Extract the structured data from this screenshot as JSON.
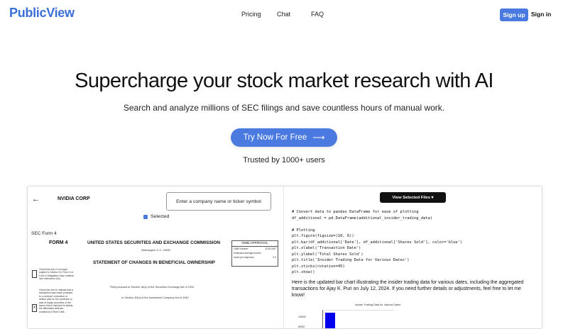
{
  "brand": {
    "name": "PublicView",
    "color": "#3b6fd8"
  },
  "nav": {
    "links": [
      "Pricing",
      "Chat",
      "FAQ"
    ],
    "signup": "Sign up",
    "signin": "Sign in"
  },
  "hero": {
    "title": "Supercharge your stock market research with AI",
    "subtitle": "Search and analyze millions of SEC filings and save countless hours of manual work.",
    "cta": "Try Now For Free",
    "cta_arrow": "⟶",
    "trusted": "Trusted by 1000+ users"
  },
  "app": {
    "back_arrow": "←",
    "company": "NVIDIA CORP",
    "search_placeholder": "Enter a company name or ticker symbol",
    "selected_label": "Selected",
    "doc": {
      "form_line": "SEC Form 4",
      "form4": "FORM 4",
      "commission": "UNITED STATES SECURITIES AND EXCHANGE COMMISSION",
      "city": "Washington, D.C. 20549",
      "statement": "STATEMENT OF CHANGES IN BENEFICIAL OWNERSHIP",
      "filed_1": "Filed pursuant to Section 16(a) of the Securities Exchange Act of 1934",
      "filed_2": "or Section 30(h) of the Investment Company Act of 1940",
      "omb_title": "OMB APPROVAL",
      "omb_number_label": "OMB Number:",
      "omb_number": "3235-0287",
      "omb_burden_label": "Estimated average burden",
      "omb_hours_label": "hours per response:",
      "omb_hours": "0.5",
      "check1": "Check this box if no longer subject to Section 16. Form 4 or Form 5 obligations may continue. See Instruction 1(b).",
      "check2": "Check this box to indicate that a transaction was made pursuant to a contract, instruction or written plan for the purchase or sale of equity securities of the issuer that is intended to satisfy the affirmative defense conditions of Rule 10b5-",
      "check2_mark": "X"
    },
    "view_files_button": "View Selected Files ▾",
    "code_lines": [
      "# Convert data to pandas DataFrame for ease of plotting",
      "df_additional = pd.DataFrame(additional_insider_trading_data)",
      "",
      "# Plotting",
      "plt.figure(figsize=(10, 6))",
      "plt.bar(df_additional['Date'], df_additional['Shares Sold'], color='blue')",
      "plt.xlabel('Transaction Date')",
      "plt.ylabel('Total Shares Sold')",
      "plt.title('Insider Trading Data for Various Dates')",
      "plt.xticks(rotation=45)",
      "plt.show()"
    ],
    "answer_text": "Here is the updated bar chart illustrating the insider trading data for various dates, including the aggregated transactions for Ajay K. Puri on July 12, 2024. If you need further details or adjustments, feel free to let me know!",
    "mini_chart": {
      "title": "Insider Trading Data for Various Dates",
      "tick_top": "100000",
      "tick_bottom": "80000",
      "bar_color": "#0000ee"
    }
  }
}
